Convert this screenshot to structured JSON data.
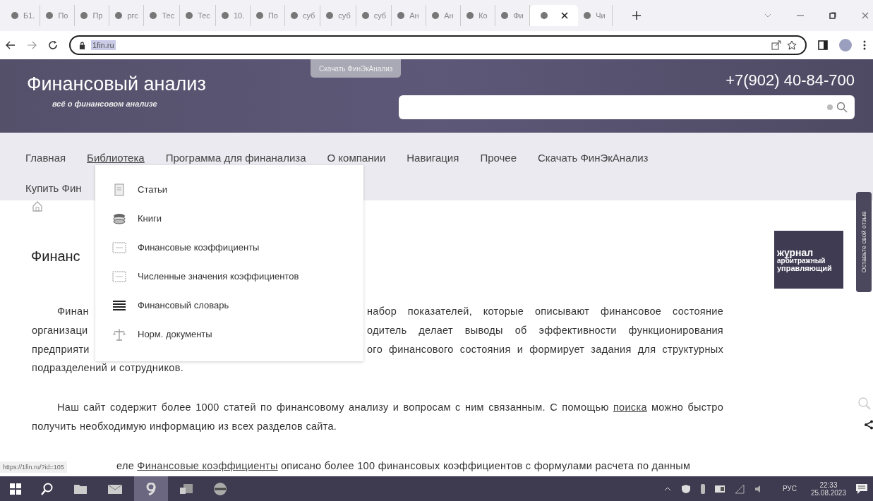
{
  "browser": {
    "tabs": [
      {
        "label": "Б1.",
        "selected": false
      },
      {
        "label": "По",
        "selected": false
      },
      {
        "label": "Пр",
        "selected": false
      },
      {
        "label": "ргс",
        "selected": false
      },
      {
        "label": "Тес",
        "selected": false
      },
      {
        "label": "Тес",
        "selected": false
      },
      {
        "label": "10.",
        "selected": false
      },
      {
        "label": "По",
        "selected": false
      },
      {
        "label": "суб",
        "selected": false
      },
      {
        "label": "суб",
        "selected": false
      },
      {
        "label": "суб",
        "selected": false
      },
      {
        "label": "Ан",
        "selected": false
      },
      {
        "label": "Ан",
        "selected": false
      },
      {
        "label": "Ко",
        "selected": false
      },
      {
        "label": "Фи",
        "selected": false
      },
      {
        "selected": true
      },
      {
        "label": "Чи",
        "selected": false
      }
    ],
    "address": "1fin.ru"
  },
  "header": {
    "title": "Финансовый анализ",
    "subtitle": "всё о финансовом анализе",
    "download_button": "Скачать ФинЭкАнализ",
    "phone": "+7(902) 40-84-700"
  },
  "nav": [
    {
      "label": "Главная",
      "selected": false
    },
    {
      "label": "Библиотека",
      "selected": true
    },
    {
      "label": "Программа для финанализа",
      "selected": false
    },
    {
      "label": "О компании",
      "selected": false
    },
    {
      "label": "Навигация",
      "selected": false
    },
    {
      "label": "Прочее",
      "selected": false
    },
    {
      "label": "Скачать ФинЭкАнализ",
      "selected": false
    },
    {
      "label": "Купить Фин",
      "selected": false
    }
  ],
  "dropdown": [
    "Статьи",
    "Книги",
    "Финансовые коэффициенты",
    "Численные значения коэффициентов",
    "Финансовый словарь",
    "Норм. документы"
  ],
  "article": {
    "heading": "Финанс",
    "lines": [
      {
        "left": "Финан",
        "right": "набор показателей, которые описывают финансовое состояние",
        "indent": true
      },
      {
        "left": "организаци",
        "right": "одитель делает выводы об эффективности функционирования",
        "indent": false
      },
      {
        "left": "предприяти",
        "right": "ого финансового состояния и формирует задания для структурных",
        "indent": false
      }
    ],
    "paragraph_end": "подразделений и сотрудников.",
    "paragraph_2": {
      "before": "Наш сайт содержит более 1000 статей по финансовому анализу и вопросам с ним связанным. С помощью ",
      "link": "поиска",
      "after": " можно быстро получить необходимую информацию из всех разделов сайта."
    },
    "paragraph_3": {
      "before": "еле ",
      "link": "Финансовые коэффициенты",
      "after": " описано более 100 финансовых коэффициентов с формулами расчета по данным"
    }
  },
  "ad": [
    "журнал",
    "арбитражный",
    "управляющий"
  ],
  "feedback_tab": "Оставьте свой отзыв",
  "status_url": "https://1fin.ru/?id=105",
  "taskbar": {
    "language": "РУС",
    "time": "22:33",
    "date": "25.08.2023"
  }
}
